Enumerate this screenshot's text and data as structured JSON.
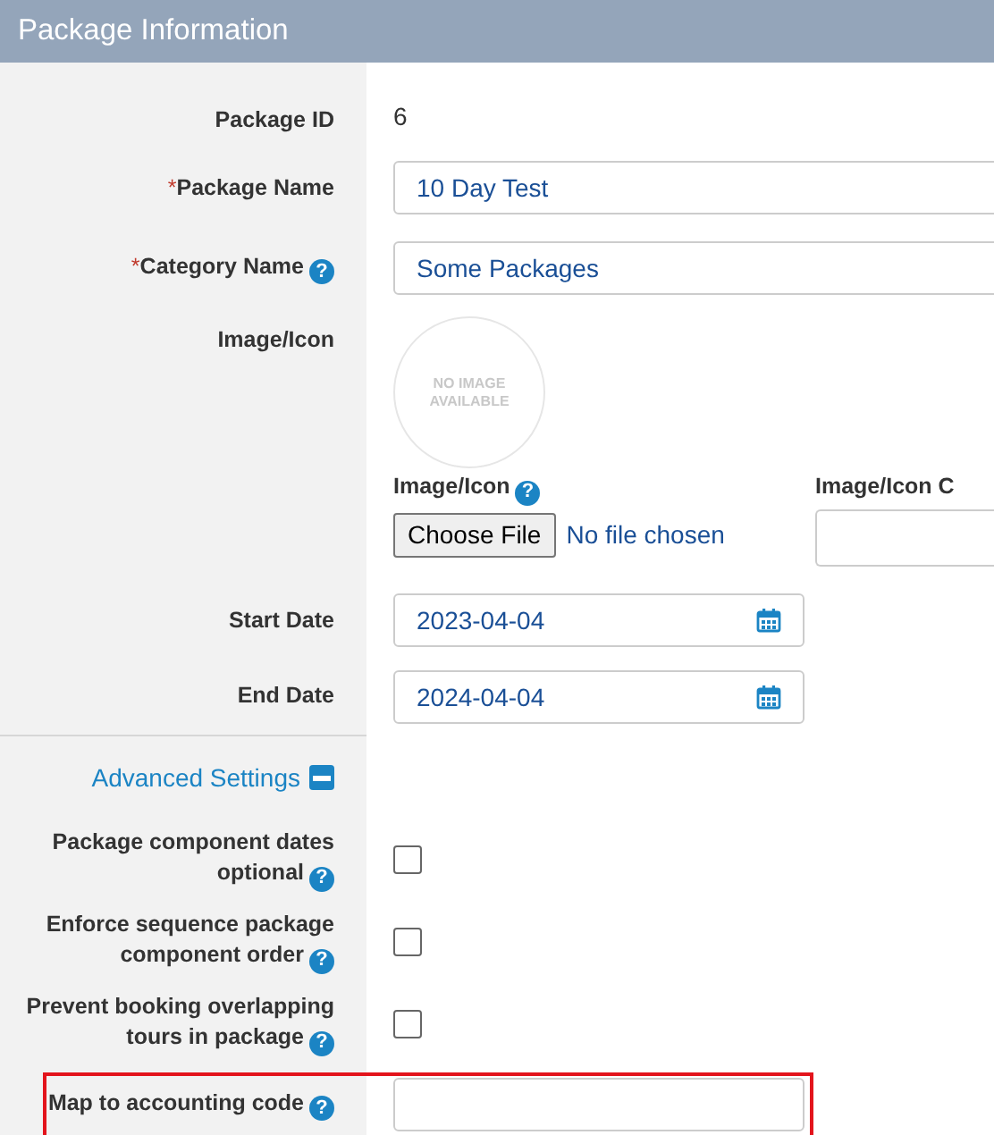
{
  "header": {
    "title": "Package Information"
  },
  "fields": [
    {
      "kind": "static",
      "label": "Package ID",
      "value": "6"
    },
    {
      "kind": "text",
      "required_mark": "*",
      "label": "Package Name",
      "value": "10 Day Test"
    },
    {
      "kind": "text",
      "required_mark": "*",
      "label": "Category Name",
      "help": "?",
      "value": "Some Packages"
    },
    {
      "kind": "image",
      "label": "Image/Icon",
      "placeholder_text": "NO IMAGE AVAILABLE",
      "upload_label": "Image/Icon",
      "upload_help": "?",
      "button": "Choose File",
      "file_status": "No file chosen",
      "second_label": "Image/Icon C"
    },
    {
      "kind": "date",
      "label": "Start Date",
      "value": "2023-04-04"
    },
    {
      "kind": "date",
      "label": "End Date",
      "value": "2024-04-04"
    }
  ],
  "advanced": {
    "label": "Advanced Settings",
    "expanded": true
  },
  "settings": [
    {
      "kind": "checkbox",
      "label": "Package component dates optional",
      "help": "?",
      "checked": false,
      "highlighted": false
    },
    {
      "kind": "checkbox",
      "label": "Enforce sequence package component order",
      "help": "?",
      "checked": false,
      "highlighted": false
    },
    {
      "kind": "checkbox",
      "label": "Prevent booking overlapping tours in package",
      "help": "?",
      "checked": false,
      "highlighted": false
    },
    {
      "kind": "input",
      "label": "Map to accounting code",
      "help": "?",
      "highlighted": true
    }
  ]
}
